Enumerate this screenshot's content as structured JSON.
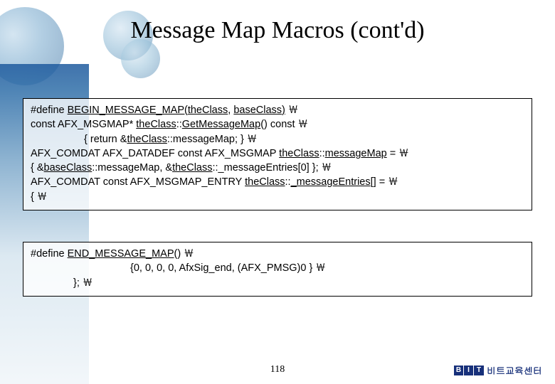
{
  "title": "Message Map Macros (cont'd)",
  "box1": {
    "l1a": "#define ",
    "l1b": "BEGIN_MESSAGE_MAP(",
    "l1c": "theClass",
    "l1d": ", ",
    "l1e": "baseClass",
    "l1f": ")",
    "l1g": " ￦",
    "l2a": "const AFX_MSGMAP* ",
    "l2b": "theClass",
    "l2c": "::",
    "l2d": "GetMessageMap",
    "l2e": "() const ￦",
    "l3a": "{ return &",
    "l3b": "theClass",
    "l3c": "::messageMap; } ￦",
    "l4a": "AFX_COMDAT AFX_DATADEF const AFX_MSGMAP ",
    "l4b": "theClass",
    "l4c": "::",
    "l4d": "messageMap",
    "l4e": " = ￦",
    "l5a": "{ &",
    "l5b": "baseClass",
    "l5c": "::messageMap, &",
    "l5d": "theClass",
    "l5e": "::_messageEntries[0] }; ￦",
    "l6a": "AFX_COMDAT const AFX_MSGMAP_ENTRY ",
    "l6b": "theClass",
    "l6c": "::",
    "l6d": "_messageEntries",
    "l6e": "[] = ￦",
    "l7": "{ ￦"
  },
  "box2": {
    "l1a": "#define ",
    "l1b": "END_MESSAGE_MAP",
    "l1c": "() ￦",
    "l2": "{0, 0, 0, 0, AfxSig_end, (AFX_PMSG)0 } ￦",
    "l3": "}; ￦"
  },
  "pageNumber": "118",
  "logo": {
    "b": "B",
    "i": "I",
    "t": "T"
  },
  "footerText": "비트교육센터"
}
